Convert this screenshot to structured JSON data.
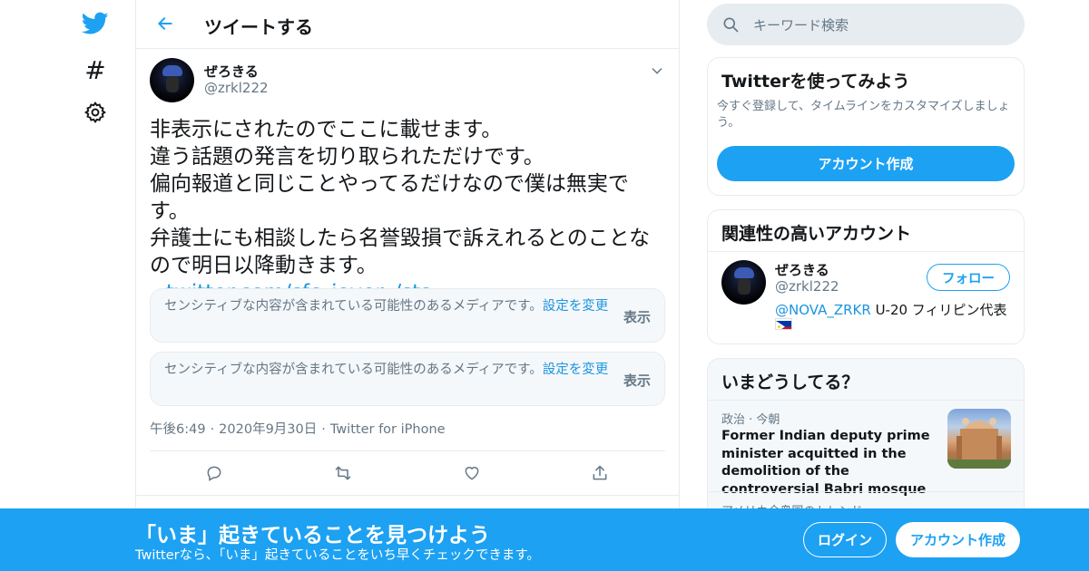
{
  "colors": {
    "accent": "#1da1f2",
    "link": "#1b95e0",
    "muted": "#657786",
    "border": "#e6ecf0"
  },
  "nav": {
    "icons": [
      "twitter-bird-icon",
      "hashtag-icon",
      "settings-gear-icon"
    ],
    "hash_glyph": "#"
  },
  "header": {
    "title": "ツイートする"
  },
  "tweet": {
    "author_name": "ぜろきる",
    "author_handle": "@zrkl222",
    "text_lines": [
      "非表示にされたのでここに載せます。",
      "違う話題の発言を切り取られただけです。",
      "偏向報道と同じことやってるだけなので僕は無実で",
      "す。",
      "弁護士にも相談したら名誉毀損で訴えれるとのことな",
      "ので明日以降動きます。"
    ],
    "link": "twitter.com/sfc_iover_/sta...",
    "media": [
      {
        "message": "センシティブな内容が含まれている可能性のあるメディアです。",
        "settings_link": "設定を変更",
        "show_label": "表示"
      },
      {
        "message": "センシティブな内容が含まれている可能性のあるメディアです。",
        "settings_link": "設定を変更",
        "show_label": "表示"
      }
    ],
    "time": "午後6:49",
    "date": "2020年9月30日",
    "source": "Twitter for iPhone",
    "meta_separator": "·"
  },
  "search": {
    "placeholder": "キーワード検索"
  },
  "signup_card": {
    "title": "Twitterを使ってみよう",
    "description": "今すぐ登録して、タイムラインをカスタマイズしましょう。",
    "button": "アカウント作成"
  },
  "related_card": {
    "title": "関連性の高いアカウント",
    "name": "ぜろきる",
    "handle": "@zrkl222",
    "follow_label": "フォロー",
    "bio_mention": "@NOVA_ZRKR",
    "bio_text": " U-20 フィリピン代表"
  },
  "trends_card": {
    "title": "いまどうしてる？",
    "category": "政治 · 今朝",
    "headline": "Former Indian deputy prime minister acquitted in the demolition of the controversial Babri mosque",
    "next_category": "アメリカ合衆国のトレンド"
  },
  "banner": {
    "title": "「いま」起きていることを見つけよう",
    "subtitle": "Twitterなら、「いま」起きていることをいち早くチェックできます。",
    "login": "ログイン",
    "signup": "アカウント作成"
  }
}
